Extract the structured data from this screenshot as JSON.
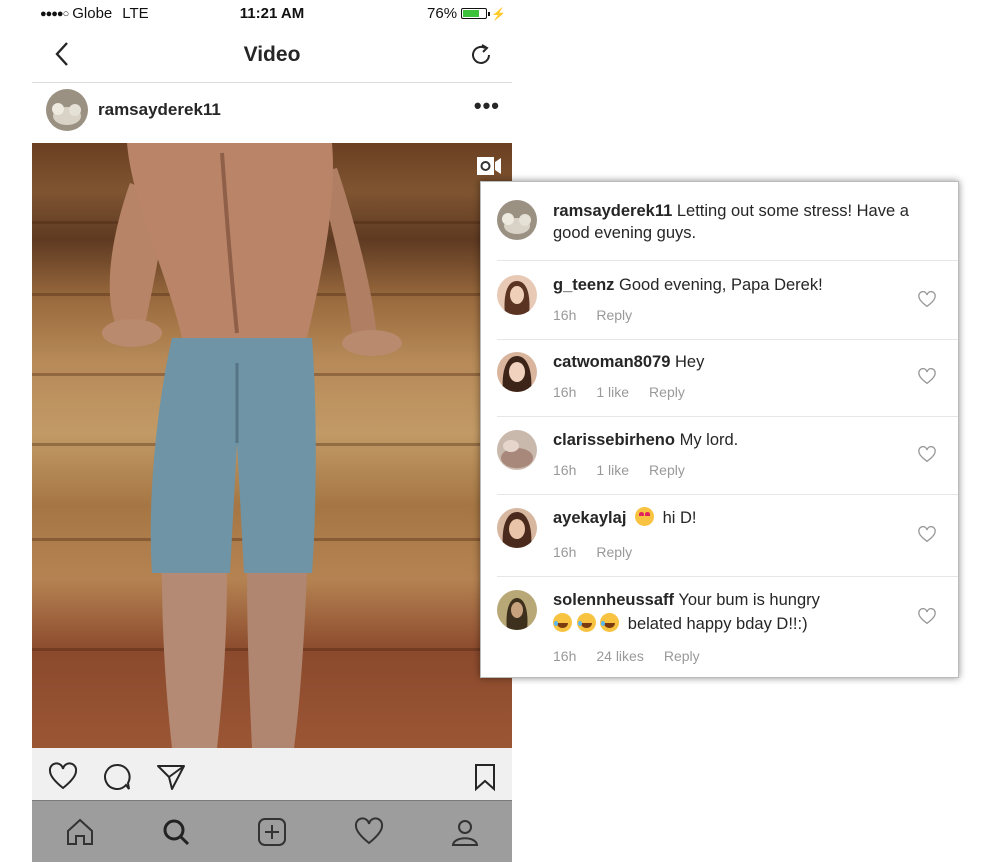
{
  "status_bar": {
    "carrier": "Globe",
    "network": "LTE",
    "time": "11:21 AM",
    "battery": "76%",
    "battery_level": 0.76
  },
  "nav": {
    "title": "Video",
    "back_icon": "chevron-left-icon",
    "refresh_icon": "refresh-icon"
  },
  "post": {
    "username": "ramsayderek11",
    "more": "•••"
  },
  "caption": {
    "username": "ramsayderek11",
    "text": "Letting out some stress! Have a good evening guys."
  },
  "comments": [
    {
      "username": "g_teenz",
      "text": "Good evening, Papa Derek!",
      "time": "16h",
      "likes": "",
      "reply": "Reply",
      "avatar_color": "#8a5a3c"
    },
    {
      "username": "catwoman8079",
      "text": "Hey",
      "time": "16h",
      "likes": "1 like",
      "reply": "Reply",
      "avatar_color": "#5c3a2a"
    },
    {
      "username": "clarissebirheno",
      "text": "My lord.",
      "time": "16h",
      "likes": "1 like",
      "reply": "Reply",
      "avatar_color": "#b59a8a"
    },
    {
      "username": "ayekaylaj",
      "emoji": "heart-eyes-emoji",
      "text": "hi D!",
      "time": "16h",
      "likes": "",
      "reply": "Reply",
      "avatar_color": "#6b3f2c"
    },
    {
      "username": "solennheussaff",
      "text": "Your bum is hungry",
      "text2": "belated happy bday D!!:)",
      "emojis": [
        "laughing-emoji",
        "laughing-emoji",
        "laughing-emoji"
      ],
      "time": "16h",
      "likes": "24 likes",
      "reply": "Reply",
      "avatar_color": "#7a6a40"
    }
  ],
  "colors": {
    "accent_battery": "#3cc13b",
    "meta_text": "#999999",
    "tab_bar": "#9d9d9d"
  },
  "icons": {
    "actions": [
      "heart-icon",
      "comment-icon",
      "send-icon",
      "bookmark-icon"
    ],
    "tabs": [
      "home-icon",
      "search-icon",
      "add-post-icon",
      "activity-heart-icon",
      "profile-icon"
    ]
  }
}
